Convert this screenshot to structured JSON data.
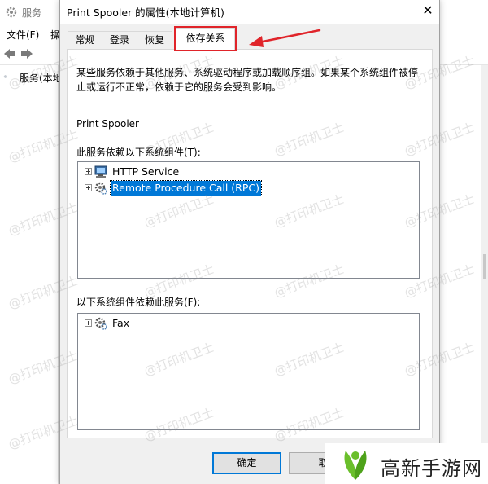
{
  "background_window": {
    "title": "服务",
    "menu": [
      "文件(F)",
      "操"
    ],
    "tree_item": "服务(本地"
  },
  "dialog": {
    "title": "Print Spooler 的属性(本地计算机)",
    "close_glyph": "✕",
    "tabs": [
      "常规",
      "登录",
      "恢复",
      "依存关系"
    ],
    "active_tab": "依存关系",
    "description": "某些服务依赖于其他服务、系统驱动程序或加载顺序组。如果某个系统组件被停止或运行不正常，依赖于它的服务会受到影响。",
    "service_name": "Print Spooler",
    "depends_on_label": "此服务依赖以下系统组件(T):",
    "depends_on": [
      {
        "label": "HTTP Service",
        "icon": "computer-icon",
        "selected": false
      },
      {
        "label": "Remote Procedure Call (RPC)",
        "icon": "gear-service-icon",
        "selected": true
      }
    ],
    "dependents_label": "以下系统组件依赖此服务(F):",
    "dependents": [
      {
        "label": "Fax",
        "icon": "gear-service-icon",
        "selected": false
      }
    ],
    "ok_label": "确定",
    "cancel_label": "取"
  },
  "watermark_text": "@打印机卫士",
  "brand": {
    "text": "高新手游网",
    "colors": {
      "green": "#6abf2b",
      "dark": "#222222"
    }
  },
  "colors": {
    "selection": "#0078d7",
    "highlight_box": "#e0242a",
    "arrow": "#e0242a"
  }
}
